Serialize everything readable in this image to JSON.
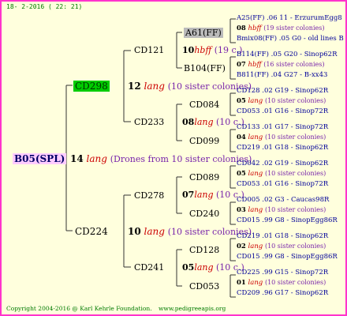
{
  "header": {
    "date": "18-  2-2016 ( 22: 21)"
  },
  "footer": {
    "copyright": "Copyright 2004-2016 @ Karl Kehrle Foundation.",
    "site": "www.pedigreeapis.org"
  },
  "colors": {
    "frame": "#ff33cc",
    "background": "#ffffdd",
    "root_bg": "#ffccff",
    "highlight_green": "#00cc00",
    "highlight_gray": "#bbbbbb",
    "lang_red": "#cc0000",
    "desc_purple": "#7722aa",
    "sub_blue": "#000099",
    "text_green": "#007a00"
  },
  "root": {
    "label": "B05(SPL)"
  },
  "root_link": {
    "number": "14",
    "lang": "lang",
    "desc": "(Drones from 10 sister colonies)"
  },
  "gen1": {
    "upper": {
      "label": "CD298",
      "number": "12",
      "lang": "lang",
      "desc": "(10 sister colonies)"
    },
    "lower": {
      "label": "CD224",
      "number": "10",
      "lang": "lang",
      "desc": "(10 sister colonies)"
    }
  },
  "gen2": [
    {
      "label": "CD121",
      "number": "10",
      "lang": "hbff",
      "desc": "(19 c.)"
    },
    {
      "label": "CD233",
      "number": "08",
      "lang": "lang",
      "desc": "(10 c.)"
    },
    {
      "label": "CD278",
      "number": "07",
      "lang": "lang",
      "desc": "(10 c.)"
    },
    {
      "label": "CD241",
      "number": "05",
      "lang": "lang",
      "desc": "(10 c.)"
    }
  ],
  "gen3": [
    {
      "label": "A61(FF)"
    },
    {
      "label": "B104(FF)"
    },
    {
      "label": "CD084"
    },
    {
      "label": "CD099"
    },
    {
      "label": "CD089"
    },
    {
      "label": "CD240"
    },
    {
      "label": "CD128"
    },
    {
      "label": "CD053"
    }
  ],
  "gen4": [
    {
      "top": "A25(FF) .06 11 - ErzurumEgg8",
      "number": "08",
      "lang": "hbff",
      "desc": "(19 sister colonies)",
      "bottom": "Bmix08(FF) .05 G0 - old lines B"
    },
    {
      "top": "B114(FF) .05    G20 - Sinop62R",
      "number": "07",
      "lang": "hbff",
      "desc": "(16 sister colonies)",
      "bottom": "B811(FF) .04      G27 - B-xx43"
    },
    {
      "top": "CD128 .02      G19 - Sinop62R",
      "number": "05",
      "lang": "lang",
      "desc": "(10 sister colonies)",
      "bottom": "CD053 .01      G16 - Sinop72R"
    },
    {
      "top": "CD133 .01      G17 - Sinop72R",
      "number": "04",
      "lang": "lang",
      "desc": "(10 sister colonies)",
      "bottom": "CD219 .01      G18 - Sinop62R"
    },
    {
      "top": "CD042 .02      G19 - Sinop62R",
      "number": "05",
      "lang": "lang",
      "desc": "(10 sister colonies)",
      "bottom": "CD053 .01      G16 - Sinop72R"
    },
    {
      "top": "CD005 .02      G3 - Caucas98R",
      "number": "03",
      "lang": "lang",
      "desc": "(10 sister colonies)",
      "bottom": "CD015 .99   G8 - SinopEgg86R"
    },
    {
      "top": "CD219 .01      G18 - Sinop62R",
      "number": "02",
      "lang": "lang",
      "desc": "(10 sister colonies)",
      "bottom": "CD015 .99   G8 - SinopEgg86R"
    },
    {
      "top": "CD225 .99      G15 - Sinop72R",
      "number": "01",
      "lang": "lang",
      "desc": "(10 sister colonies)",
      "bottom": "CD209 .96      G17 - Sinop62R"
    }
  ]
}
